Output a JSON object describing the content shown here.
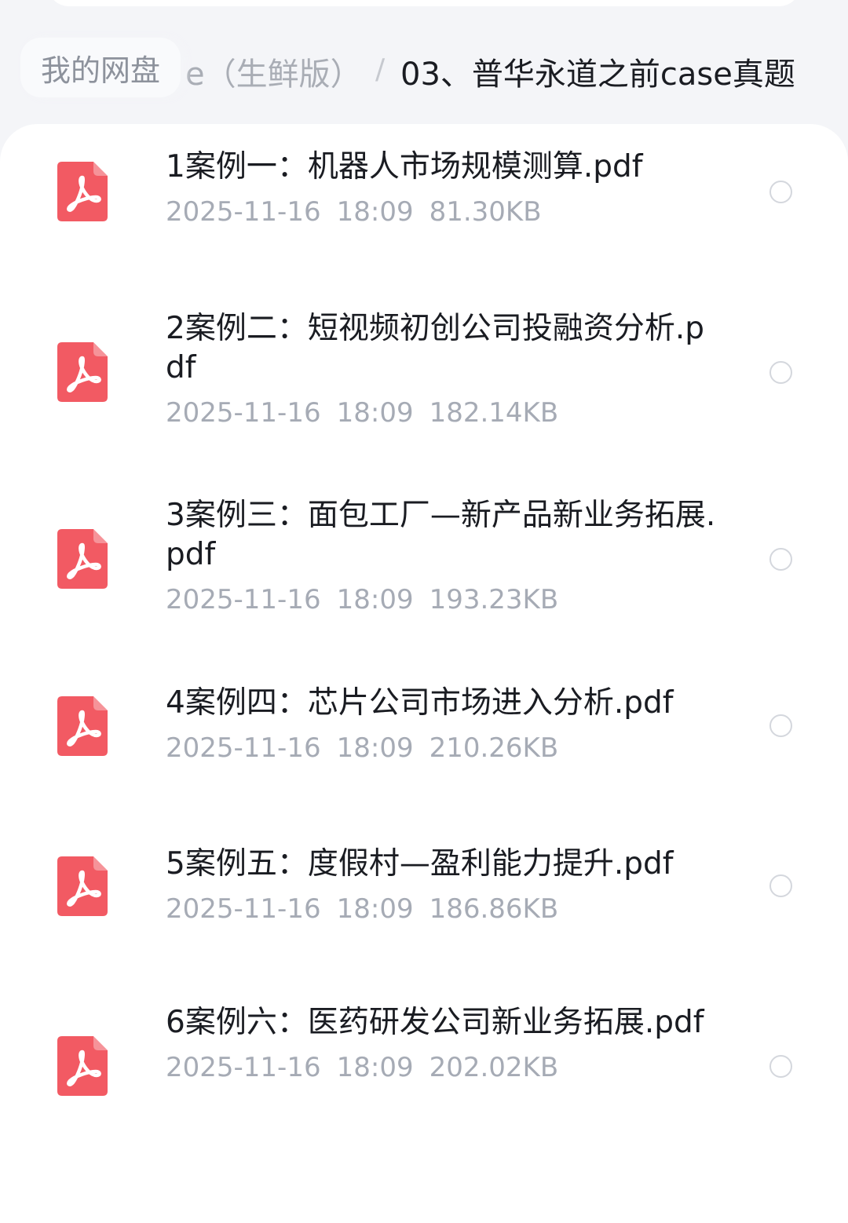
{
  "breadcrumb": {
    "root": "我的网盘",
    "middle": "e（生鲜版）",
    "separator": "/",
    "current": "03、普华永道之前case真题"
  },
  "files": [
    {
      "name": "1案例一：机器人市场规模测算.pdf",
      "date": "2025-11-16",
      "time": "18:09",
      "size": "81.30KB",
      "icon": "pdf-icon"
    },
    {
      "name": "2案例二：短视频初创公司投融资分析.pdf",
      "date": "2025-11-16",
      "time": "18:09",
      "size": "182.14KB",
      "icon": "pdf-icon"
    },
    {
      "name": "3案例三：面包工厂—新产品新业务拓展.pdf",
      "date": "2025-11-16",
      "time": "18:09",
      "size": "193.23KB",
      "icon": "pdf-icon"
    },
    {
      "name": "4案例四：芯片公司市场进入分析.pdf",
      "date": "2025-11-16",
      "time": "18:09",
      "size": "210.26KB",
      "icon": "pdf-icon"
    },
    {
      "name": "5案例五：度假村—盈利能力提升.pdf",
      "date": "2025-11-16",
      "time": "18:09",
      "size": "186.86KB",
      "icon": "pdf-icon"
    },
    {
      "name": "6案例六：医药研发公司新业务拓展.pdf",
      "date": "2025-11-16",
      "time": "18:09",
      "size": "202.02KB",
      "icon": "pdf-icon"
    }
  ],
  "colors": {
    "pdf_icon": "#f25a63",
    "title_text": "#1a1c22",
    "meta_text": "#a6abb5",
    "background": "#f4f5f8"
  }
}
